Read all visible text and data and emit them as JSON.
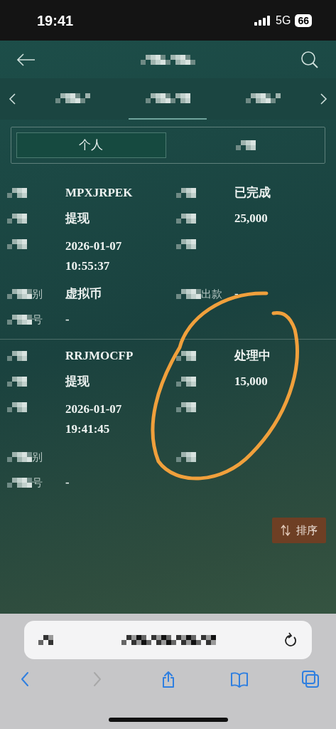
{
  "status_bar": {
    "time": "19:41",
    "network": "5G",
    "battery": "66"
  },
  "nav_tabs": [
    {
      "selected": false
    },
    {
      "selected": true
    },
    {
      "selected": false
    }
  ],
  "segments": [
    {
      "label": "个人",
      "selected": true
    },
    {
      "selected": false
    }
  ],
  "records": [
    {
      "rows": [
        {
          "left": {
            "value": "MPXJRPEK"
          },
          "right": {
            "value": "已完成"
          }
        },
        {
          "left": {
            "value": "提现"
          },
          "right": {
            "value": "25,000"
          }
        },
        {
          "left": {
            "lines": [
              "2026-01-07",
              "10:55:37"
            ]
          },
          "right": {}
        },
        {
          "left": {
            "label_tail": "别",
            "value": "虚拟币"
          },
          "right": {
            "label_tail": "出款",
            "value": "-"
          }
        },
        {
          "left": {
            "label_tail": "号",
            "value": "-"
          }
        }
      ]
    },
    {
      "rows": [
        {
          "left": {
            "value": "RRJMOCFP"
          },
          "right": {
            "value": "处理中"
          }
        },
        {
          "left": {
            "value": "提现"
          },
          "right": {
            "value": "15,000"
          }
        },
        {
          "left": {
            "lines": [
              "2026-01-07",
              "19:41:45"
            ]
          },
          "right": {}
        },
        {
          "left": {
            "label_tail": "别"
          },
          "right": {}
        },
        {
          "left": {
            "label_tail": "号",
            "value": "-"
          }
        }
      ]
    }
  ],
  "sort_button": {
    "label": "排序"
  },
  "browser_toolbar": [
    {
      "kind": "back",
      "disabled": false
    },
    {
      "kind": "forward",
      "disabled": true
    },
    {
      "kind": "share",
      "disabled": false
    },
    {
      "kind": "bookmarks",
      "disabled": false
    },
    {
      "kind": "tabs",
      "disabled": false
    }
  ]
}
